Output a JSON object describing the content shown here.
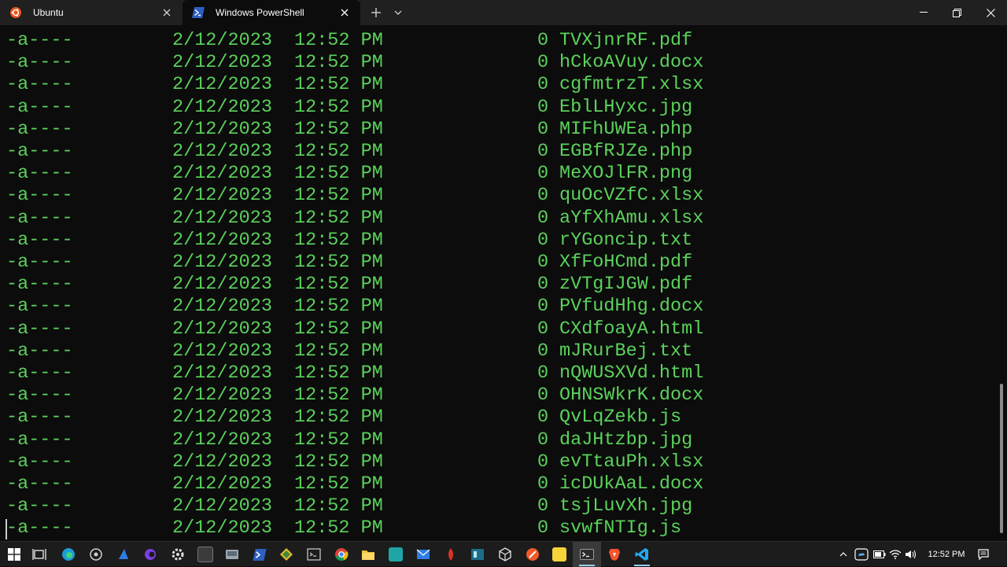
{
  "tabs": [
    {
      "label": "Ubuntu",
      "icon": "ubuntu-icon"
    },
    {
      "label": "Windows PowerShell",
      "icon": "powershell-icon"
    }
  ],
  "colors": {
    "terminal_bg": "#0c0c0c",
    "text_green": "#5bd25b",
    "titlebar_bg": "#202020",
    "ubuntu_orange": "#e95420",
    "powershell_blue": "#2c5fbf"
  },
  "listing": [
    {
      "mode": "-a----",
      "date": "2/12/2023",
      "time": "12:52 PM",
      "length": "0",
      "name": "TVXjnrRF.pdf"
    },
    {
      "mode": "-a----",
      "date": "2/12/2023",
      "time": "12:52 PM",
      "length": "0",
      "name": "hCkoAVuy.docx"
    },
    {
      "mode": "-a----",
      "date": "2/12/2023",
      "time": "12:52 PM",
      "length": "0",
      "name": "cgfmtrzT.xlsx"
    },
    {
      "mode": "-a----",
      "date": "2/12/2023",
      "time": "12:52 PM",
      "length": "0",
      "name": "EblLHyxc.jpg"
    },
    {
      "mode": "-a----",
      "date": "2/12/2023",
      "time": "12:52 PM",
      "length": "0",
      "name": "MIFhUWEa.php"
    },
    {
      "mode": "-a----",
      "date": "2/12/2023",
      "time": "12:52 PM",
      "length": "0",
      "name": "EGBfRJZe.php"
    },
    {
      "mode": "-a----",
      "date": "2/12/2023",
      "time": "12:52 PM",
      "length": "0",
      "name": "MeXOJlFR.png"
    },
    {
      "mode": "-a----",
      "date": "2/12/2023",
      "time": "12:52 PM",
      "length": "0",
      "name": "quOcVZfC.xlsx"
    },
    {
      "mode": "-a----",
      "date": "2/12/2023",
      "time": "12:52 PM",
      "length": "0",
      "name": "aYfXhAmu.xlsx"
    },
    {
      "mode": "-a----",
      "date": "2/12/2023",
      "time": "12:52 PM",
      "length": "0",
      "name": "rYGoncip.txt"
    },
    {
      "mode": "-a----",
      "date": "2/12/2023",
      "time": "12:52 PM",
      "length": "0",
      "name": "XfFoHCmd.pdf"
    },
    {
      "mode": "-a----",
      "date": "2/12/2023",
      "time": "12:52 PM",
      "length": "0",
      "name": "zVTgIJGW.pdf"
    },
    {
      "mode": "-a----",
      "date": "2/12/2023",
      "time": "12:52 PM",
      "length": "0",
      "name": "PVfudHhg.docx"
    },
    {
      "mode": "-a----",
      "date": "2/12/2023",
      "time": "12:52 PM",
      "length": "0",
      "name": "CXdfoayA.html"
    },
    {
      "mode": "-a----",
      "date": "2/12/2023",
      "time": "12:52 PM",
      "length": "0",
      "name": "mJRurBej.txt"
    },
    {
      "mode": "-a----",
      "date": "2/12/2023",
      "time": "12:52 PM",
      "length": "0",
      "name": "nQWUSXVd.html"
    },
    {
      "mode": "-a----",
      "date": "2/12/2023",
      "time": "12:52 PM",
      "length": "0",
      "name": "OHNSWkrK.docx"
    },
    {
      "mode": "-a----",
      "date": "2/12/2023",
      "time": "12:52 PM",
      "length": "0",
      "name": "QvLqZekb.js"
    },
    {
      "mode": "-a----",
      "date": "2/12/2023",
      "time": "12:52 PM",
      "length": "0",
      "name": "daJHtzbp.jpg"
    },
    {
      "mode": "-a----",
      "date": "2/12/2023",
      "time": "12:52 PM",
      "length": "0",
      "name": "evTtauPh.xlsx"
    },
    {
      "mode": "-a----",
      "date": "2/12/2023",
      "time": "12:52 PM",
      "length": "0",
      "name": "icDUkAaL.docx"
    },
    {
      "mode": "-a----",
      "date": "2/12/2023",
      "time": "12:52 PM",
      "length": "0",
      "name": "tsjLuvXh.jpg"
    },
    {
      "mode": "-a----",
      "date": "2/12/2023",
      "time": "12:52 PM",
      "length": "0",
      "name": "svwfNTIg.js"
    }
  ],
  "taskbar": {
    "apps": [
      "windows-start-icon",
      "task-view-icon",
      "edge-icon",
      "app-icon",
      "app-icon",
      "app-icon",
      "settings-gear-icon",
      "app-icon",
      "app-icon",
      "powershell-icon",
      "app-icon",
      "app-icon",
      "chrome-icon",
      "file-explorer-icon",
      "app-icon",
      "mail-icon",
      "app-icon",
      "app-icon",
      "app-icon",
      "app-icon",
      "sticky-notes-icon",
      "windows-terminal-icon",
      "brave-icon",
      "vscode-icon"
    ],
    "clock": "12:52 PM"
  }
}
